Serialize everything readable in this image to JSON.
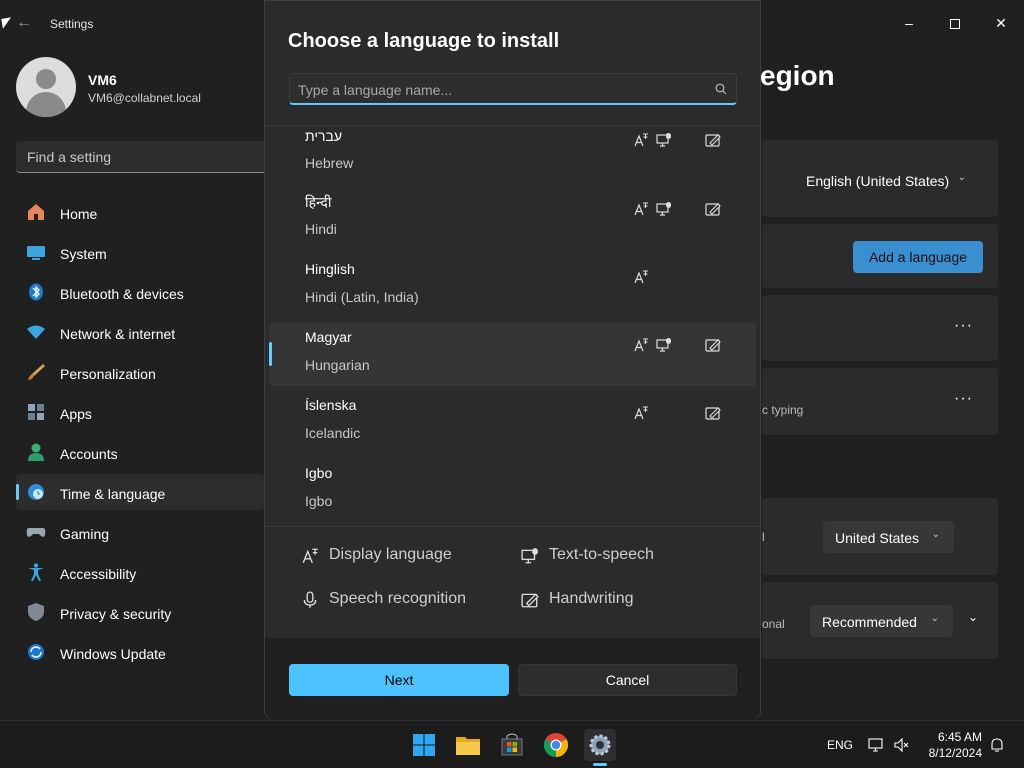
{
  "window": {
    "title": "Settings",
    "back_icon": "back-arrow-icon",
    "minimize_icon": "minimize-icon",
    "maximize_icon": "maximize-icon",
    "close_icon": "close-icon"
  },
  "profile": {
    "name": "VM6",
    "email": "VM6@collabnet.local"
  },
  "sidebar": {
    "search_placeholder": "Find a setting",
    "items": [
      {
        "label": "Home",
        "icon": "home-icon"
      },
      {
        "label": "System",
        "icon": "system-icon"
      },
      {
        "label": "Bluetooth & devices",
        "icon": "bluetooth-icon"
      },
      {
        "label": "Network & internet",
        "icon": "wifi-icon"
      },
      {
        "label": "Personalization",
        "icon": "brush-icon"
      },
      {
        "label": "Apps",
        "icon": "apps-icon"
      },
      {
        "label": "Accounts",
        "icon": "accounts-icon"
      },
      {
        "label": "Time & language",
        "icon": "globe-clock-icon",
        "active": true
      },
      {
        "label": "Gaming",
        "icon": "gamepad-icon"
      },
      {
        "label": "Accessibility",
        "icon": "accessibility-icon"
      },
      {
        "label": "Privacy & security",
        "icon": "shield-icon"
      },
      {
        "label": "Windows Update",
        "icon": "update-icon"
      }
    ]
  },
  "background": {
    "title_fragment": "egion",
    "display_language_value": "English (United States)",
    "add_language_label": "Add a language",
    "typing_fragment": "c typing",
    "country_value": "United States",
    "country_fragment": "l",
    "regional_fragment": "onal",
    "regional_format_value": "Recommended"
  },
  "dialog": {
    "title": "Choose a language to install",
    "search_placeholder": "Type a language name...",
    "languages": [
      {
        "native": "עברית",
        "english": "Hebrew",
        "display": true,
        "tts": true,
        "handwriting": true
      },
      {
        "native": "हिन्दी",
        "english": "Hindi",
        "display": true,
        "tts": true,
        "handwriting": true
      },
      {
        "native": "Hinglish",
        "english": "Hindi (Latin, India)",
        "display": true,
        "tts": false,
        "handwriting": false
      },
      {
        "native": "Magyar",
        "english": "Hungarian",
        "display": true,
        "tts": true,
        "handwriting": true,
        "selected": true
      },
      {
        "native": "Íslenska",
        "english": "Icelandic",
        "display": true,
        "tts": false,
        "handwriting": true
      },
      {
        "native": "Igbo",
        "english": "Igbo",
        "display": false,
        "tts": false,
        "handwriting": false
      }
    ],
    "legend": {
      "display_language": "Display language",
      "text_to_speech": "Text-to-speech",
      "speech_recognition": "Speech recognition",
      "handwriting": "Handwriting"
    },
    "next_label": "Next",
    "cancel_label": "Cancel"
  },
  "taskbar": {
    "apps": [
      "windows-start-icon",
      "file-explorer-icon",
      "store-icon",
      "chrome-icon",
      "settings-icon"
    ],
    "language": "ENG",
    "time": "6:45 AM",
    "date": "8/12/2024"
  },
  "colors": {
    "accent": "#60cdff",
    "next_button": "#4cc2ff",
    "add_language_button": "#3a8fd0",
    "background": "#202020",
    "dialog": "#2b2b2b"
  }
}
